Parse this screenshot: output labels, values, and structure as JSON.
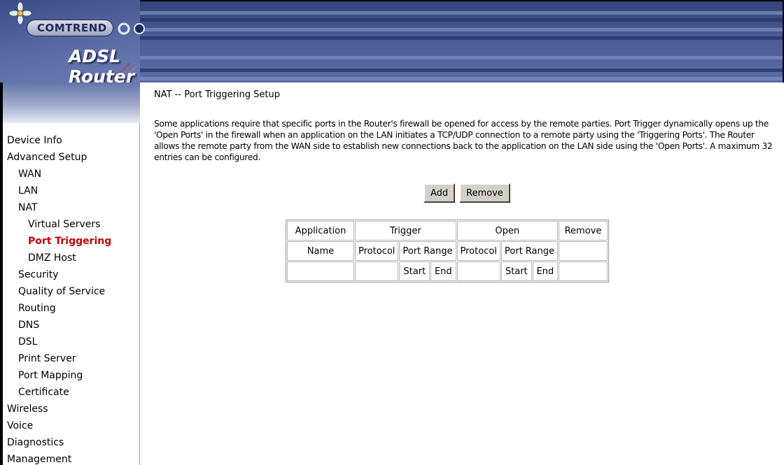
{
  "header": {
    "brand": "COMTREND",
    "product": "ADSL Router"
  },
  "sidebar": {
    "items": [
      {
        "label": "Device Info",
        "level": 1
      },
      {
        "label": "Advanced Setup",
        "level": 1
      },
      {
        "label": "WAN",
        "level": 2
      },
      {
        "label": "LAN",
        "level": 2
      },
      {
        "label": "NAT",
        "level": 2
      },
      {
        "label": "Virtual Servers",
        "level": 3
      },
      {
        "label": "Port Triggering",
        "level": 3,
        "active": true
      },
      {
        "label": "DMZ Host",
        "level": 3
      },
      {
        "label": "Security",
        "level": 2
      },
      {
        "label": "Quality of Service",
        "level": 2
      },
      {
        "label": "Routing",
        "level": 2
      },
      {
        "label": "DNS",
        "level": 2
      },
      {
        "label": "DSL",
        "level": 2
      },
      {
        "label": "Print Server",
        "level": 2
      },
      {
        "label": "Port Mapping",
        "level": 2
      },
      {
        "label": "Certificate",
        "level": 2
      },
      {
        "label": "Wireless",
        "level": 1
      },
      {
        "label": "Voice",
        "level": 1
      },
      {
        "label": "Diagnostics",
        "level": 1
      },
      {
        "label": "Management",
        "level": 1
      }
    ],
    "active_color": "#c00000"
  },
  "main": {
    "title": "NAT -- Port Triggering Setup",
    "description": "Some applications require that specific ports in the Router's firewall be opened for access by the remote parties. Port Trigger dynamically opens up the 'Open Ports' in the firewall when an application on the LAN initiates a TCP/UDP connection to a remote party using the 'Triggering Ports'. The Router allows the remote party from the WAN side to establish new connections back to the application on the LAN side using the 'Open Ports'. A maximum 32 entries can be configured.",
    "buttons": {
      "add": "Add",
      "remove": "Remove"
    },
    "table": {
      "header_row1": {
        "application": "Application",
        "trigger": "Trigger",
        "open": "Open",
        "remove": "Remove"
      },
      "header_row2": {
        "name": "Name",
        "trigger_protocol": "Protocol",
        "trigger_port_range": "Port Range",
        "open_protocol": "Protocol",
        "open_port_range": "Port Range"
      },
      "header_row3": {
        "trigger_start": "Start",
        "trigger_end": "End",
        "open_start": "Start",
        "open_end": "End"
      }
    }
  }
}
